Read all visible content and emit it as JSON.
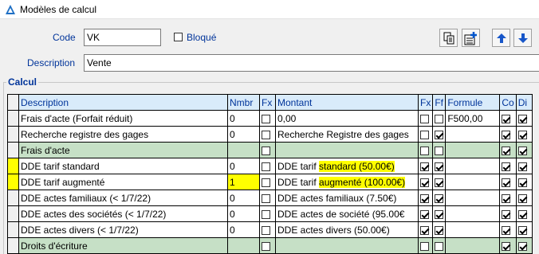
{
  "window": {
    "title": "Modèles de calcul"
  },
  "form": {
    "code_label": "Code",
    "code_value": "VK",
    "bloque_label": "Bloqué",
    "description_label": "Description",
    "description_value": "Vente",
    "calcul_label": "Calcul"
  },
  "toolbar": {
    "icons": [
      "copy-icon",
      "add-record-icon",
      "arrow-up-icon",
      "arrow-down-icon"
    ]
  },
  "table": {
    "headers": {
      "description": "Description",
      "nmbr": "Nmbr",
      "fx": "Fx",
      "montant": "Montant",
      "fx2": "Fx",
      "ff": "Ff",
      "formule": "Formule",
      "co": "Co",
      "di": "Di"
    },
    "rows": [
      {
        "description": "Frais d'acte (Forfait réduit)",
        "nmbr": "0",
        "fx": false,
        "montant": "0,00",
        "fx2": false,
        "ff": false,
        "formule": "F500,00",
        "co": true,
        "di": true,
        "group": false,
        "marker": false
      },
      {
        "description": "Recherche registre des gages",
        "nmbr": "0",
        "fx": false,
        "montant": "Recherche Registre des gages",
        "fx2": false,
        "ff": true,
        "formule": "",
        "co": true,
        "di": true,
        "group": false,
        "marker": false
      },
      {
        "description": "Frais d'acte",
        "nmbr": "",
        "fx": false,
        "montant": "",
        "fx2": false,
        "ff": false,
        "formule": "",
        "co": true,
        "di": true,
        "group": true,
        "marker": false
      },
      {
        "description": "DDE tarif standard",
        "nmbr": "0",
        "fx": false,
        "montant_pre": "DDE tarif ",
        "montant_hl": "standard (50.00€)",
        "fx2": true,
        "ff": true,
        "formule": "",
        "co": true,
        "di": true,
        "group": false,
        "marker": true
      },
      {
        "description": "DDE tarif augmenté",
        "nmbr": "1",
        "fx": false,
        "montant_pre": "DDE tarif ",
        "montant_hl": "augmenté (100.00€)",
        "fx2": true,
        "ff": true,
        "formule": "",
        "co": true,
        "di": true,
        "group": false,
        "marker": true,
        "nmbr_hl": true
      },
      {
        "description": "DDE actes familiaux (< 1/7/22)",
        "nmbr": "0",
        "fx": false,
        "montant": "DDE actes familiaux (7.50€)",
        "fx2": true,
        "ff": true,
        "formule": "",
        "co": true,
        "di": true,
        "group": false,
        "marker": false
      },
      {
        "description": "DDE actes des sociétés (< 1/7/22)",
        "nmbr": "0",
        "fx": false,
        "montant": "DDE actes de société (95.00€",
        "fx2": true,
        "ff": true,
        "formule": "",
        "co": true,
        "di": true,
        "group": false,
        "marker": false
      },
      {
        "description": "DDE actes divers (< 1/7/22)",
        "nmbr": "0",
        "fx": false,
        "montant": "DDE actes divers (50.00€)",
        "fx2": true,
        "ff": true,
        "formule": "",
        "co": true,
        "di": true,
        "group": false,
        "marker": false
      },
      {
        "description": "Droits d'écriture",
        "nmbr": "",
        "fx": false,
        "montant": "",
        "fx2": false,
        "ff": false,
        "formule": "",
        "co": true,
        "di": true,
        "group": true,
        "marker": false
      }
    ]
  }
}
